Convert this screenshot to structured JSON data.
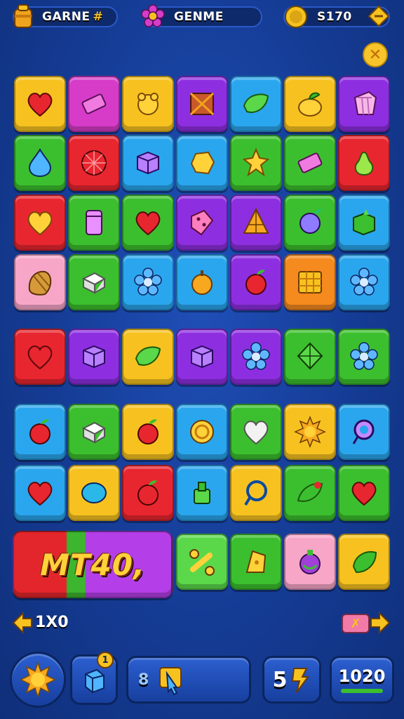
{
  "header": {
    "left_title": "GARNE",
    "center_title": "GENME",
    "coins": "S170"
  },
  "banner": {
    "text": "MT40,"
  },
  "controls": {
    "left_counter": "1X0",
    "hint_number": "8",
    "moves": "5",
    "score": "1020",
    "badge": "1"
  },
  "colors": {
    "red": "#e8262f",
    "magenta": "#d63cc8",
    "yellow": "#f7c21f",
    "purple": "#8d2fe0",
    "blue": "#2aa6ee",
    "green": "#3cbf2e",
    "lime": "#5ad84a",
    "orange": "#f58a1f",
    "pink": "#f7a6c8",
    "teal": "#1fc07a"
  },
  "board": {
    "rows": [
      [
        {
          "c": "yellow",
          "i": "heart"
        },
        {
          "c": "magenta",
          "i": "bar"
        },
        {
          "c": "yellow",
          "i": "blob"
        },
        {
          "c": "purple",
          "i": "crate"
        },
        {
          "c": "blue",
          "i": "leaf"
        },
        {
          "c": "yellow",
          "i": "fruit"
        },
        {
          "c": "purple",
          "i": "gem"
        }
      ],
      [
        {
          "c": "green",
          "i": "drop"
        },
        {
          "c": "red",
          "i": "ball"
        },
        {
          "c": "blue",
          "i": "box"
        },
        {
          "c": "blue",
          "i": "nugget"
        },
        {
          "c": "green",
          "i": "star"
        },
        {
          "c": "green",
          "i": "bar"
        },
        {
          "c": "red",
          "i": "pear"
        }
      ],
      [
        {
          "c": "red",
          "i": "heart2"
        },
        {
          "c": "green",
          "i": "cup"
        },
        {
          "c": "green",
          "i": "heart"
        },
        {
          "c": "purple",
          "i": "dice"
        },
        {
          "c": "purple",
          "i": "pyramid"
        },
        {
          "c": "green",
          "i": "orb"
        },
        {
          "c": "blue",
          "i": "cube"
        }
      ],
      [
        {
          "c": "pink",
          "i": "shell"
        },
        {
          "c": "green",
          "i": "cube2"
        },
        {
          "c": "blue",
          "i": "flower"
        },
        {
          "c": "blue",
          "i": "acorn"
        },
        {
          "c": "purple",
          "i": "apple"
        },
        {
          "c": "orange",
          "i": "crate2"
        },
        {
          "c": "blue",
          "i": "flower"
        }
      ],
      [
        {
          "c": "red",
          "i": "heart"
        },
        {
          "c": "purple",
          "i": "box"
        },
        {
          "c": "yellow",
          "i": "leaf"
        },
        {
          "c": "purple",
          "i": "box"
        },
        {
          "c": "purple",
          "i": "flower"
        },
        {
          "c": "green",
          "i": "diamond"
        },
        {
          "c": "green",
          "i": "flower"
        }
      ],
      [
        {
          "c": "blue",
          "i": "apple"
        },
        {
          "c": "green",
          "i": "cube2"
        },
        {
          "c": "yellow",
          "i": "apple"
        },
        {
          "c": "blue",
          "i": "coin"
        },
        {
          "c": "green",
          "i": "heart3"
        },
        {
          "c": "yellow",
          "i": "sun"
        },
        {
          "c": "blue",
          "i": "ring"
        }
      ],
      [
        {
          "c": "blue",
          "i": "heart"
        },
        {
          "c": "yellow",
          "i": "oval"
        },
        {
          "c": "red",
          "i": "apple"
        },
        {
          "c": "blue",
          "i": "bottle"
        },
        {
          "c": "yellow",
          "i": "ring2"
        },
        {
          "c": "green",
          "i": "leaf2"
        },
        {
          "c": "green",
          "i": "heart"
        }
      ],
      [
        {
          "c": "lime",
          "i": "bone"
        },
        {
          "c": "green",
          "i": "cheese"
        },
        {
          "c": "pink",
          "i": "potion"
        },
        {
          "c": "yellow",
          "i": "leaf3"
        }
      ]
    ]
  }
}
